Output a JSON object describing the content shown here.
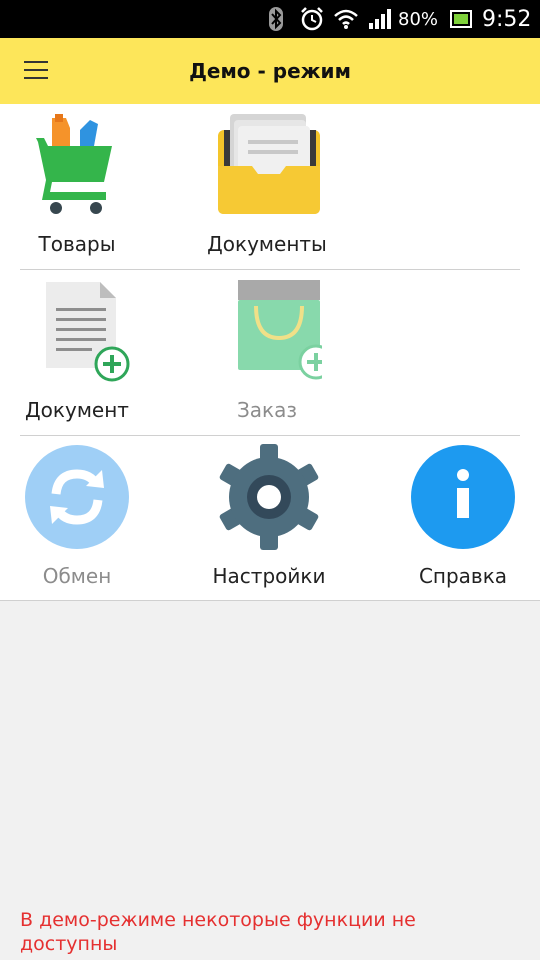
{
  "status_bar": {
    "battery_percent": "80%",
    "time": "9:52",
    "icons": [
      "bluetooth-icon",
      "alarm-icon",
      "wifi-icon",
      "signal-icon",
      "battery-icon"
    ]
  },
  "app_bar": {
    "title": "Демо - режим",
    "menu_icon": "hamburger-menu-icon",
    "background": "#fde65a"
  },
  "menu": {
    "rows": [
      [
        {
          "label": "Товары",
          "icon": "shopping-cart-icon",
          "enabled": true
        },
        {
          "label": "Документы",
          "icon": "documents-folder-icon",
          "enabled": true
        }
      ],
      [
        {
          "label": "Документ",
          "icon": "new-document-icon",
          "enabled": true
        },
        {
          "label": "Заказ",
          "icon": "new-order-bag-icon",
          "enabled": false
        }
      ],
      [
        {
          "label": "Обмен",
          "icon": "sync-icon",
          "enabled": false
        },
        {
          "label": "Настройки",
          "icon": "gear-icon",
          "enabled": true
        },
        {
          "label": "Справка",
          "icon": "info-icon",
          "enabled": true
        }
      ]
    ]
  },
  "footer": {
    "warning": "В демо-режиме некоторые функции не доступны",
    "warning_color": "#e53030"
  }
}
